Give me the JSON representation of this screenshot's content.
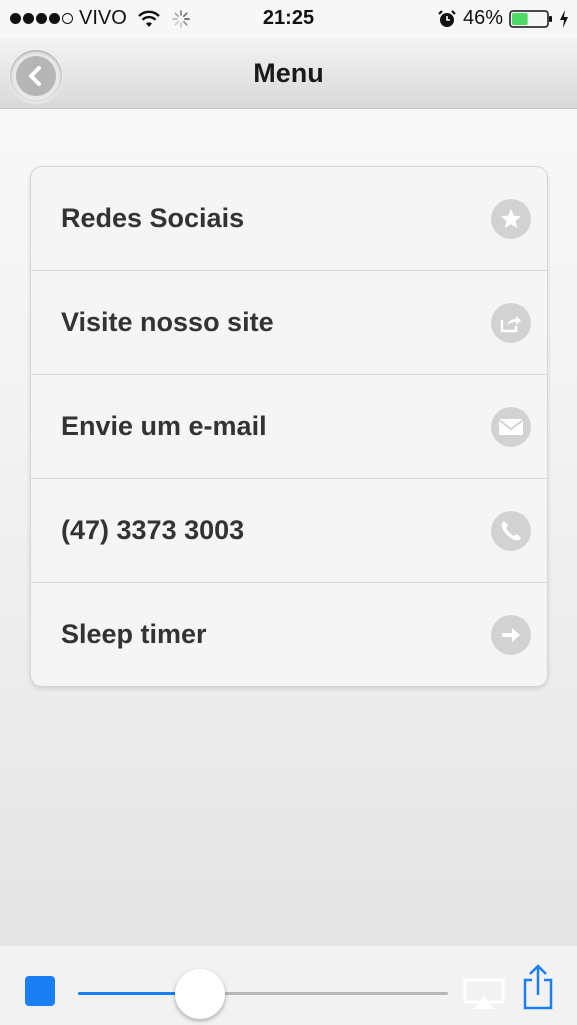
{
  "status_bar": {
    "signal_dots_filled": 4,
    "signal_dots_total": 5,
    "carrier": "VIVO",
    "time": "21:25",
    "battery_percent": "46%",
    "battery_level": 0.46,
    "icons": [
      "wifi-icon",
      "activity-spinner-icon",
      "alarm-clock-icon",
      "battery-icon",
      "charging-bolt-icon"
    ]
  },
  "nav": {
    "title": "Menu",
    "back_icon": "chevron-left-icon"
  },
  "menu": {
    "items": [
      {
        "label": "Redes Sociais",
        "icon": "star-icon"
      },
      {
        "label": "Visite nosso site",
        "icon": "share-arrow-icon"
      },
      {
        "label": "Envie um e-mail",
        "icon": "envelope-icon"
      },
      {
        "label": "(47) 3373 3003",
        "icon": "phone-icon"
      },
      {
        "label": "Sleep timer",
        "icon": "arrow-right-icon"
      }
    ]
  },
  "player": {
    "stop_icon": "stop-icon",
    "volume_level": 0.33,
    "airplay_icon": "airplay-icon",
    "share_icon": "share-icon",
    "colors": {
      "accent": "#1a7ef5"
    }
  }
}
